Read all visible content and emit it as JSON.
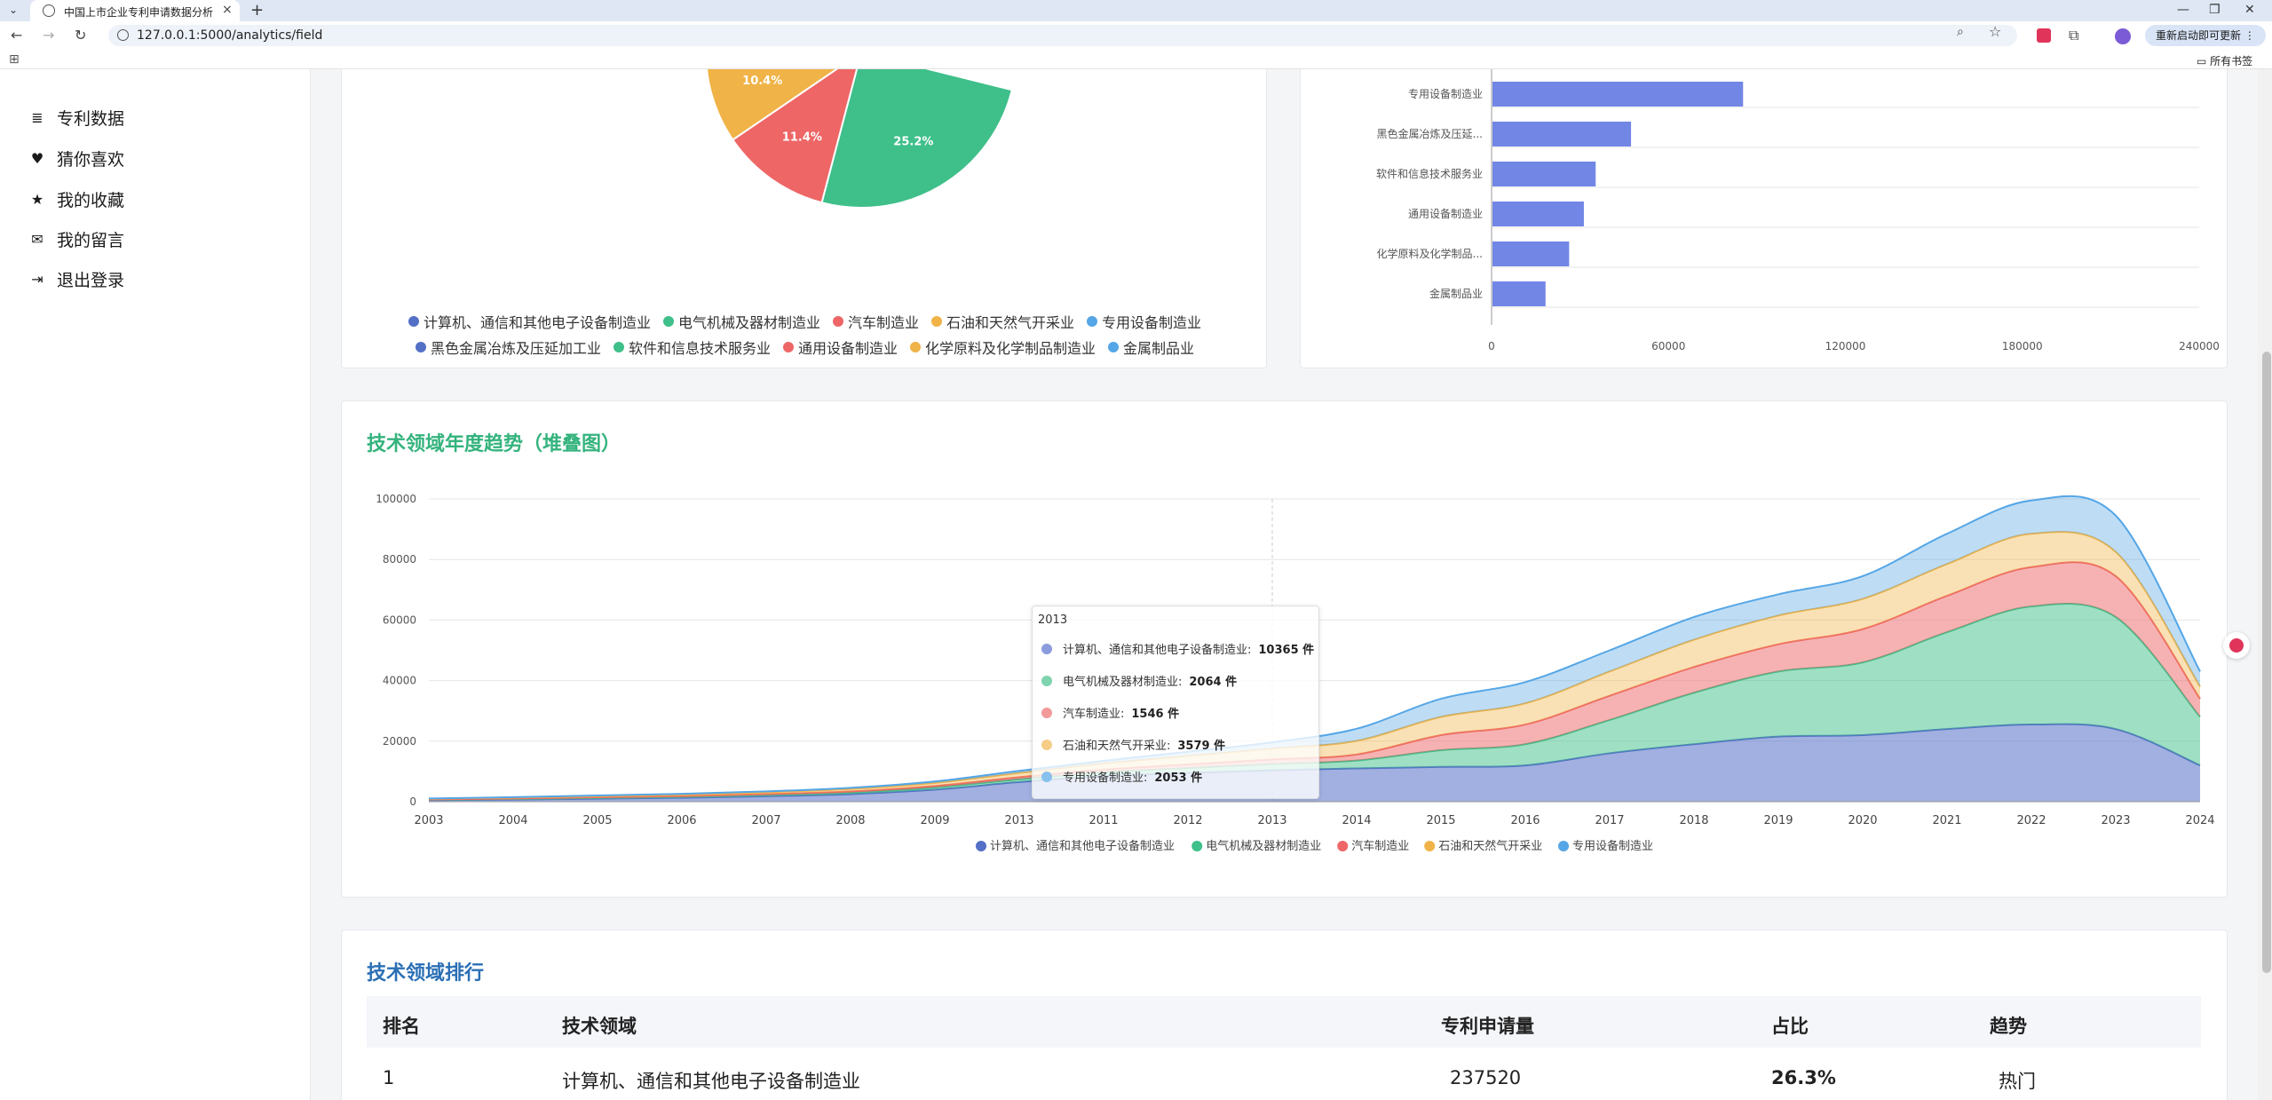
{
  "browser": {
    "tab_title": "中国上市企业专利申请数据分析",
    "url": "127.0.0.1:5000/analytics/field",
    "restart_label": "重新启动即可更新",
    "bookmarks_label": "所有书签"
  },
  "sidebar": {
    "items": [
      {
        "label": "专利数据",
        "icon": "database-icon"
      },
      {
        "label": "猜你喜欢",
        "icon": "heart-icon"
      },
      {
        "label": "我的收藏",
        "icon": "star-icon"
      },
      {
        "label": "我的留言",
        "icon": "chat-icon"
      },
      {
        "label": "退出登录",
        "icon": "logout-icon"
      }
    ]
  },
  "pie_legend": {
    "row1": [
      "计算机、通信和其他电子设备制造业",
      "电气机械及器材制造业",
      "汽车制造业",
      "石油和天然气开采业",
      "专用设备制造业"
    ],
    "row2": [
      "黑色金属冶炼及压延加工业",
      "软件和信息技术服务业",
      "通用设备制造业",
      "化学原料及化学制品制造业",
      "金属制品业"
    ]
  },
  "trend_title": "技术领域年度趋势（堆叠图）",
  "ranking": {
    "title": "技术领域排行",
    "headers": [
      "排名",
      "技术领域",
      "专利申请量",
      "占比",
      "趋势"
    ],
    "rows": [
      {
        "rank": "1",
        "field": "计算机、通信和其他电子设备制造业",
        "count": "237520",
        "share": "26.3%",
        "trend": "热门"
      }
    ]
  },
  "tooltip": {
    "year": "2013",
    "rows": [
      {
        "label": "计算机、通信和其他电子设备制造业:",
        "value": "10365 件"
      },
      {
        "label": "电气机械及器材制造业:",
        "value": "2064 件"
      },
      {
        "label": "汽车制造业:",
        "value": "1546 件"
      },
      {
        "label": "石油和天然气开采业:",
        "value": "3579 件"
      },
      {
        "label": "专用设备制造业:",
        "value": "2053 件"
      }
    ]
  },
  "colors": {
    "blue": "#5470c6",
    "green": "#3fbf8a",
    "red": "#ee6666",
    "yellow": "#f0b347",
    "sky": "#55a6e6",
    "title_green": "#34b37d",
    "title_blue": "#2a6fb5",
    "bar": "#7286e6"
  },
  "chart_data": [
    {
      "type": "pie",
      "labels_visible": [
        "10.4%",
        "11.4%",
        "25.2%"
      ],
      "slices": [
        {
          "name": "电气机械及器材制造业",
          "percent": 25.2
        },
        {
          "name": "汽车制造业",
          "percent": 11.4
        },
        {
          "name": "石油和天然气开采业",
          "percent": 10.4
        }
      ]
    },
    {
      "type": "bar",
      "orientation": "horizontal",
      "categories": [
        "专用设备制造业",
        "黑色金属冶炼及压延...",
        "软件和信息技术服务业",
        "通用设备制造业",
        "化学原料及化学制品...",
        "金属制品业"
      ],
      "values": [
        85000,
        47000,
        35000,
        31000,
        26000,
        18000
      ],
      "xlim": [
        0,
        240000
      ],
      "xticks": [
        "0",
        "60000",
        "120000",
        "180000",
        "240000"
      ]
    },
    {
      "type": "area",
      "stacked": true,
      "x": [
        "2003",
        "2004",
        "2005",
        "2006",
        "2007",
        "2008",
        "2009",
        "2013",
        "2011",
        "2012",
        "2013",
        "2014",
        "2015",
        "2016",
        "2017",
        "2018",
        "2019",
        "2020",
        "2021",
        "2022",
        "2023",
        "2024"
      ],
      "ylim": [
        0,
        100000
      ],
      "yticks": [
        "0",
        "20000",
        "40000",
        "60000",
        "80000",
        "100000"
      ],
      "legend": [
        "计算机、通信和其他电子设备制造业",
        "电气机械及器材制造业",
        "汽车制造业",
        "石油和天然气开采业",
        "专用设备制造业"
      ],
      "series": [
        {
          "name": "计算机、通信和其他电子设备制造业",
          "values": [
            500,
            700,
            1000,
            1300,
            1800,
            2500,
            4000,
            6500,
            8500,
            9500,
            10365,
            11000,
            11500,
            12000,
            16000,
            19000,
            21500,
            22000,
            24000,
            25500,
            24000,
            12000
          ]
        },
        {
          "name": "电气机械及器材制造业",
          "values": [
            150,
            200,
            250,
            300,
            400,
            500,
            700,
            900,
            1200,
            1600,
            2064,
            2600,
            5500,
            7000,
            11000,
            17000,
            21500,
            24000,
            32000,
            39000,
            37000,
            16000
          ]
        },
        {
          "name": "汽车制造业",
          "values": [
            100,
            150,
            200,
            250,
            300,
            400,
            500,
            700,
            900,
            1200,
            1546,
            2000,
            5000,
            6500,
            8000,
            8500,
            9000,
            11000,
            12000,
            13000,
            13500,
            6000
          ]
        },
        {
          "name": "石油和天然气开采业",
          "values": [
            200,
            300,
            400,
            500,
            600,
            800,
            1000,
            1400,
            2000,
            2800,
            3579,
            4500,
            6000,
            7000,
            8000,
            9000,
            9500,
            10000,
            10500,
            11000,
            8000,
            4000
          ]
        },
        {
          "name": "专用设备制造业",
          "values": [
            100,
            150,
            200,
            250,
            300,
            400,
            500,
            700,
            900,
            1400,
            2053,
            4000,
            6000,
            7000,
            7000,
            7500,
            7000,
            7500,
            10000,
            11000,
            12000,
            5000
          ]
        }
      ]
    }
  ]
}
